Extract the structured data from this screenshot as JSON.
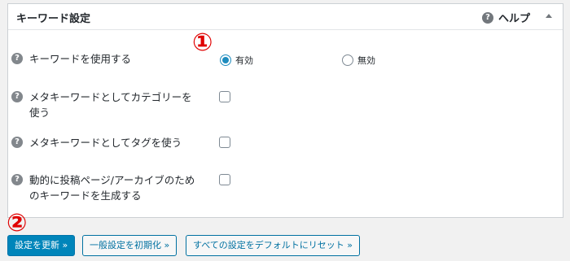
{
  "panel": {
    "title": "キーワード設定",
    "help_icon": "?",
    "help_label": "ヘルプ",
    "toggle_icon": "triangle-up-icon"
  },
  "settings": {
    "use_keywords": {
      "label": "キーワードを使用する",
      "options": [
        {
          "label": "有効",
          "checked": true
        },
        {
          "label": "無効",
          "checked": false
        }
      ]
    },
    "category_keywords": {
      "label": "メタキーワードとしてカテゴリーを使う",
      "checked": false
    },
    "tag_keywords": {
      "label": "メタキーワードとしてタグを使う",
      "checked": false
    },
    "dynamic_keywords": {
      "label": "動的に投稿ページ/アーカイブのためのキーワードを生成する",
      "checked": false
    }
  },
  "question_icon": "?",
  "markers": {
    "first": "①",
    "second": "②"
  },
  "buttons": {
    "update": "設定を更新 »",
    "reset_general": "一般設定を初期化 »",
    "reset_all": "すべての設定をデフォルトにリセット »"
  },
  "colors": {
    "primary": "#0085ba",
    "radio_checked": "#1e8cbe",
    "marker": "#e00000"
  }
}
